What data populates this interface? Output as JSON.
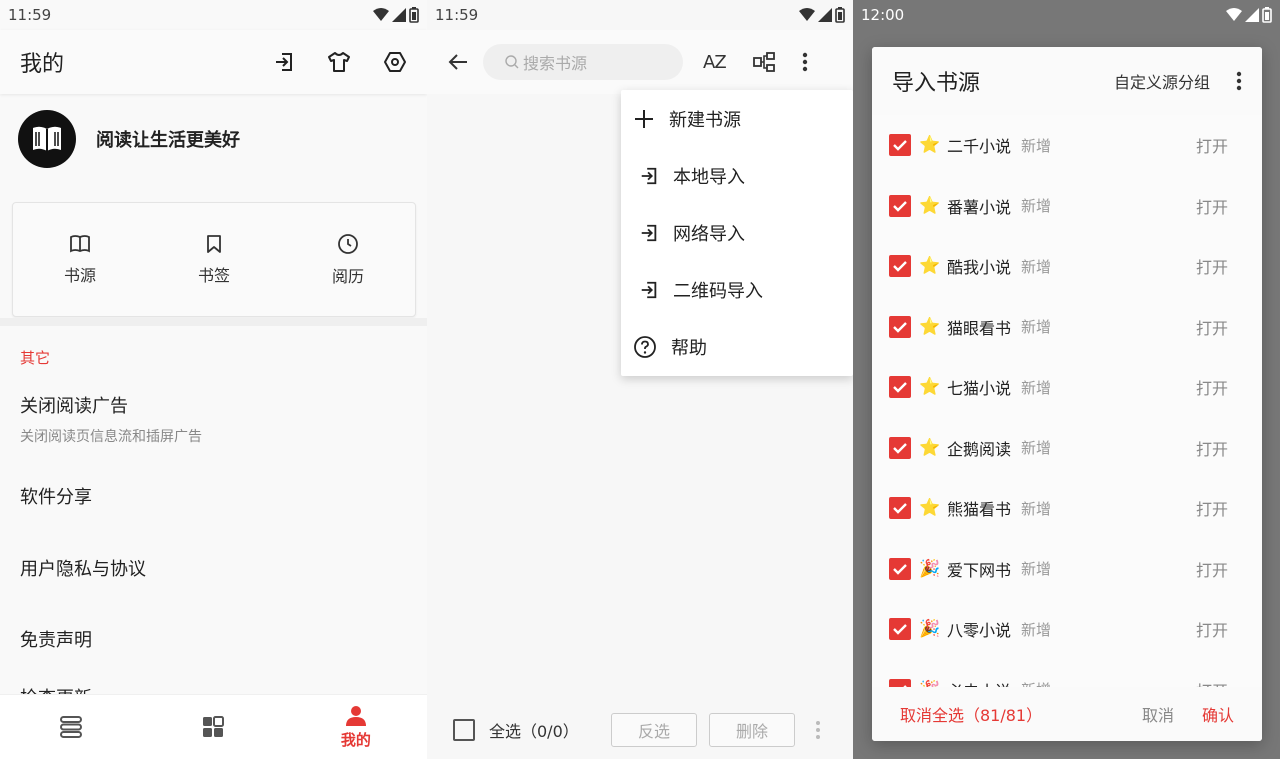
{
  "screen1": {
    "status": {
      "time": "11:59"
    },
    "appbar": {
      "title": "我的",
      "icons": [
        "import-icon",
        "theme-shirt-icon",
        "settings-icon"
      ]
    },
    "profile": {
      "slogan": "阅读让生活更美好",
      "avatar_icon": "book-logo-icon"
    },
    "quick": [
      {
        "label": "书源",
        "icon": "open-book-icon"
      },
      {
        "label": "书签",
        "icon": "bookmark-icon"
      },
      {
        "label": "阅历",
        "icon": "clock-icon"
      }
    ],
    "section": "其它",
    "prefs": [
      {
        "title": "关闭阅读广告",
        "summary": "关闭阅读页信息流和插屏广告"
      },
      {
        "title": "软件分享"
      },
      {
        "title": "用户隐私与协议"
      },
      {
        "title": "免责声明"
      },
      {
        "title": "检查更新"
      }
    ],
    "bottom_nav": [
      {
        "label": "",
        "icon": "bookshelf-icon"
      },
      {
        "label": "",
        "icon": "explore-grid-icon"
      },
      {
        "label": "我的",
        "icon": "person-icon",
        "active": true
      }
    ],
    "accent_color": "#e53935"
  },
  "screen2": {
    "status": {
      "time": "11:59"
    },
    "search": {
      "placeholder": "搜索书源"
    },
    "toolbar": {
      "sort_label": "AZ"
    },
    "menu": [
      {
        "label": "新建书源",
        "icon": "plus-icon"
      },
      {
        "label": "本地导入",
        "icon": "import-icon"
      },
      {
        "label": "网络导入",
        "icon": "import-icon"
      },
      {
        "label": "二维码导入",
        "icon": "import-icon"
      },
      {
        "label": "帮助",
        "icon": "help-icon"
      }
    ],
    "bottom": {
      "select_all": "全选（0/0）",
      "invert": "反选",
      "delete": "删除"
    }
  },
  "screen3": {
    "status": {
      "time": "12:00"
    },
    "dialog": {
      "title": "导入书源",
      "group_label": "自定义源分组",
      "items": [
        {
          "emoji": "⭐",
          "name": "二千小说",
          "tag": "新增",
          "action": "打开"
        },
        {
          "emoji": "⭐",
          "name": "番薯小说",
          "tag": "新增",
          "action": "打开"
        },
        {
          "emoji": "⭐",
          "name": "酷我小说",
          "tag": "新增",
          "action": "打开"
        },
        {
          "emoji": "⭐",
          "name": "猫眼看书",
          "tag": "新增",
          "action": "打开"
        },
        {
          "emoji": "⭐",
          "name": "七猫小说",
          "tag": "新增",
          "action": "打开"
        },
        {
          "emoji": "⭐",
          "name": "企鹅阅读",
          "tag": "新增",
          "action": "打开"
        },
        {
          "emoji": "⭐",
          "name": "熊猫看书",
          "tag": "新增",
          "action": "打开"
        },
        {
          "emoji": "🎉",
          "name": "爱下网书",
          "tag": "新增",
          "action": "打开"
        },
        {
          "emoji": "🎉",
          "name": "八零小说",
          "tag": "新增",
          "action": "打开"
        },
        {
          "emoji": "🎉",
          "name": "必去小说",
          "tag": "新增",
          "action": "打开"
        }
      ],
      "footer": {
        "unselect_all": "取消全选（81/81）",
        "cancel": "取消",
        "confirm": "确认"
      }
    }
  }
}
